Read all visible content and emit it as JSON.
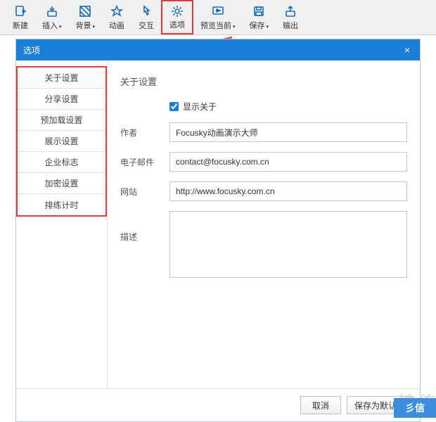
{
  "toolbar": {
    "items": [
      {
        "id": "new",
        "label": "新建",
        "has_caret": false
      },
      {
        "id": "insert",
        "label": "插入",
        "has_caret": true
      },
      {
        "id": "background",
        "label": "背景",
        "has_caret": true
      },
      {
        "id": "animation",
        "label": "动画",
        "has_caret": false
      },
      {
        "id": "interact",
        "label": "交互",
        "has_caret": false
      },
      {
        "id": "options",
        "label": "选项",
        "has_caret": false,
        "active": true
      },
      {
        "id": "preview",
        "label": "预览当前",
        "has_caret": true
      },
      {
        "id": "save",
        "label": "保存",
        "has_caret": true
      },
      {
        "id": "export",
        "label": "输出",
        "has_caret": false
      }
    ]
  },
  "dialog": {
    "title": "选项",
    "close": "×",
    "sidebar": {
      "items": [
        {
          "id": "about",
          "label": "关于设置",
          "active": true
        },
        {
          "id": "share",
          "label": "分享设置"
        },
        {
          "id": "preload",
          "label": "预加载设置"
        },
        {
          "id": "display",
          "label": "展示设置"
        },
        {
          "id": "logo",
          "label": "企业标志"
        },
        {
          "id": "encrypt",
          "label": "加密设置"
        },
        {
          "id": "rehearse",
          "label": "排练计时"
        }
      ]
    },
    "content": {
      "section_title": "关于设置",
      "show_about_label": "显示关于",
      "show_about_checked": true,
      "author_label": "作者",
      "author_value": "Focusky动画演示大师",
      "email_label": "电子邮件",
      "email_value": "contact@focusky.com.cn",
      "website_label": "网站",
      "website_value": "http://www.focusky.com.cn",
      "description_label": "描述",
      "description_value": ""
    },
    "footer": {
      "cancel": "取消",
      "save": "保存为默认值"
    }
  },
  "colors": {
    "accent": "#1a7fd6",
    "highlight": "#e03a3a"
  },
  "watermark": {
    "gray": "快传",
    "blue": "彡信"
  }
}
